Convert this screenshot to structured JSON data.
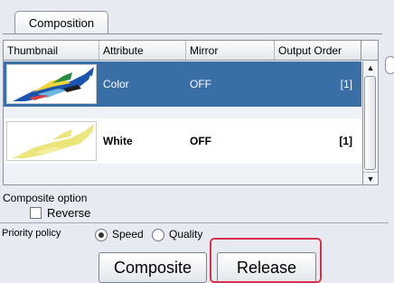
{
  "tab": {
    "label": "Composition"
  },
  "table": {
    "headers": [
      "Thumbnail",
      "Attribute",
      "Mirror",
      "Output Order"
    ],
    "rows": [
      {
        "attribute": "Color",
        "mirror": "OFF",
        "order": "[1]",
        "selected": true
      },
      {
        "attribute": "White",
        "mirror": "OFF",
        "order": "[1]",
        "selected": false
      }
    ]
  },
  "options": {
    "title": "Composite option",
    "reverse_label": "Reverse",
    "reverse_checked": false
  },
  "policy": {
    "label": "Priority policy",
    "speed_label": "Speed",
    "quality_label": "Quality",
    "selected": "Speed"
  },
  "buttons": {
    "composite": "Composite",
    "release": "Release"
  },
  "colors": {
    "selection": "#3a6ea6",
    "highlight": "#d8324a"
  }
}
